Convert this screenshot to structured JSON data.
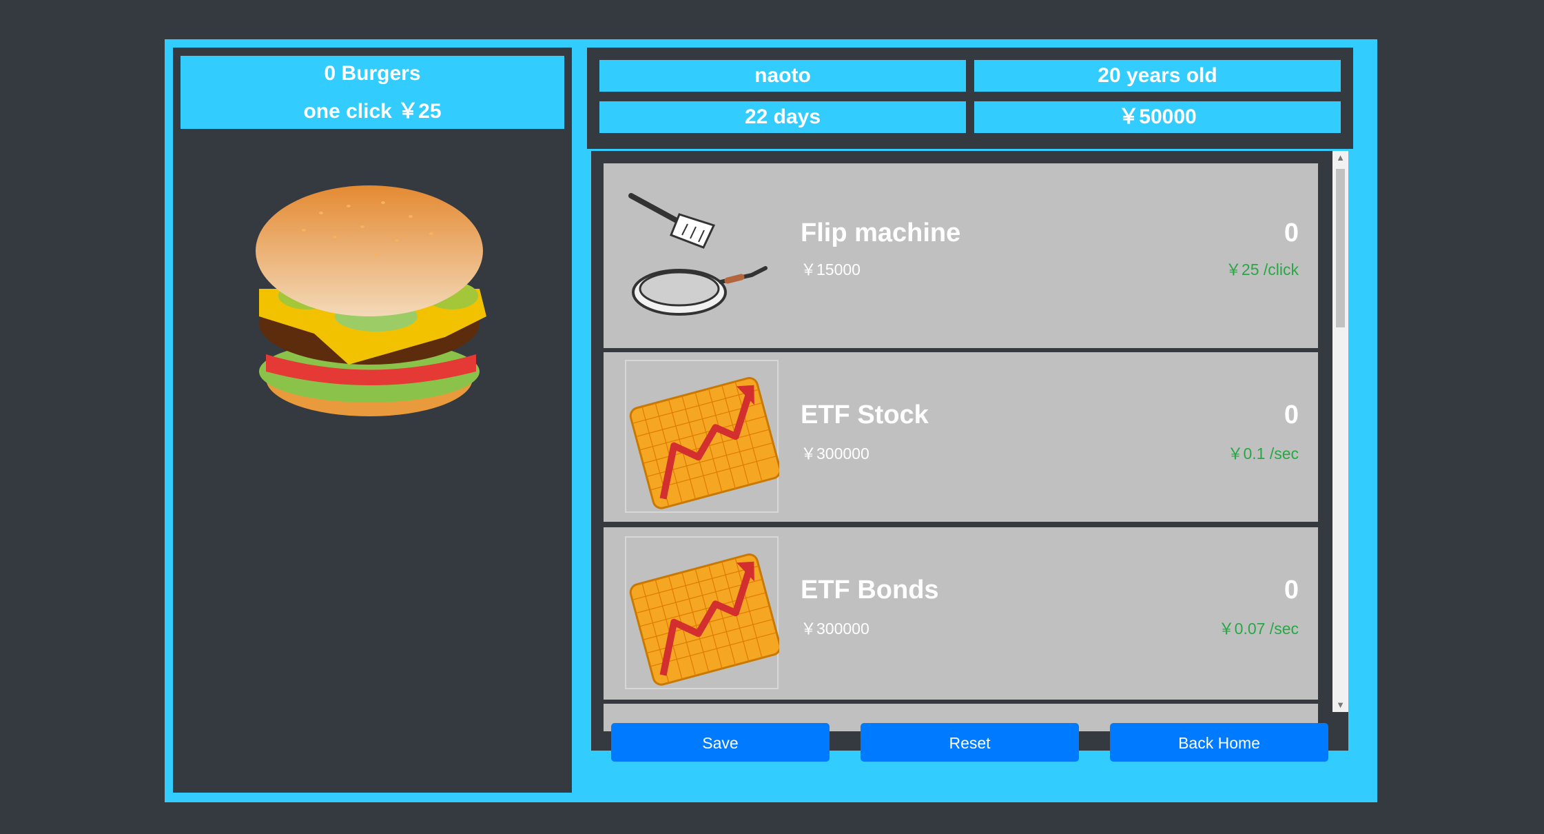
{
  "counter": {
    "burgers": "0 Burgers",
    "per_click": "one click ￥25"
  },
  "profile": {
    "name": "naoto",
    "age": "20 years old",
    "days": "22 days",
    "money": "￥50000"
  },
  "items": [
    {
      "name": "Flip machine",
      "price": "￥15000",
      "owned": "0",
      "rate": "￥25 /click",
      "icon": "frying-pan-icon"
    },
    {
      "name": "ETF Stock",
      "price": "￥300000",
      "owned": "0",
      "rate": "￥0.1 /sec",
      "icon": "stock-chart-icon"
    },
    {
      "name": "ETF Bonds",
      "price": "￥300000",
      "owned": "0",
      "rate": "￥0.07 /sec",
      "icon": "stock-chart-icon"
    }
  ],
  "buttons": {
    "save": "Save",
    "reset": "Reset",
    "back_home": "Back Home"
  },
  "colors": {
    "frame": "#33ccff",
    "panel": "#343a40",
    "button": "#007bff",
    "rate": "#28a745",
    "card": "#c0c0c0"
  }
}
